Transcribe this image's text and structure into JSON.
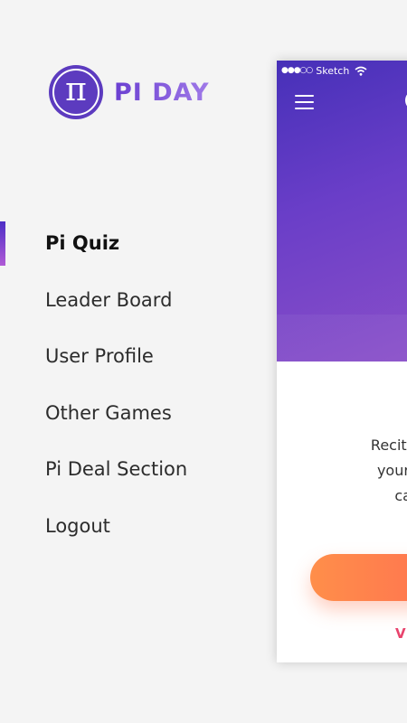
{
  "logo": {
    "symbol": "π",
    "text": "PI DAY"
  },
  "menu": {
    "items": [
      {
        "label": "Pi Quiz",
        "active": true
      },
      {
        "label": "Leader Board"
      },
      {
        "label": "User Profile"
      },
      {
        "label": "Other Games"
      },
      {
        "label": "Pi Deal Section"
      },
      {
        "label": "Logout"
      }
    ]
  },
  "phone": {
    "status": {
      "dots": "●●●○○",
      "carrier": "Sketch"
    },
    "body_lines": [
      "Recite up to",
      "your mem",
      "can y"
    ],
    "link_label": "VI"
  },
  "colors": {
    "brand_purple": "#5c3bbf",
    "header_gradient_start": "#4630b8",
    "header_gradient_end": "#8a4fc9",
    "button_orange": "#ff8e4a",
    "link_pink": "#e8436c"
  },
  "icons": [
    "pi-logo-icon",
    "wifi-icon",
    "hamburger-menu-icon"
  ]
}
